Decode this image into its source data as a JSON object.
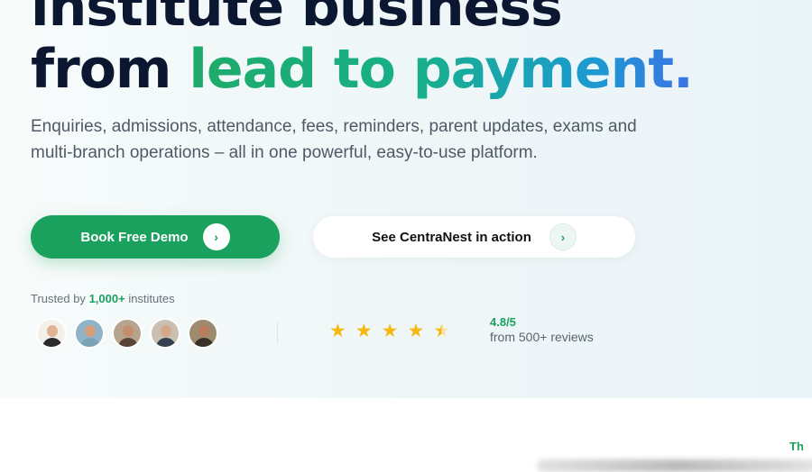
{
  "hero": {
    "headline_line1": "institute business",
    "headline_line2_prefix": "from",
    "headline_line2_highlight": "lead to payment.",
    "subheadline": "Enquiries, admissions, attendance, fees, reminders, parent updates, exams and multi-branch operations – all in one powerful, easy-to-use platform.",
    "primary_cta": {
      "label": "Book Free Demo",
      "icon": "arrow-right-icon",
      "arrow_glyph": "›"
    },
    "secondary_cta": {
      "label": "See CentraNest in action",
      "icon": "arrow-right-icon",
      "arrow_glyph": "›"
    },
    "trusted": {
      "prefix": "Trusted by",
      "count": "1,000+",
      "suffix": "institutes"
    },
    "avatars": [
      {
        "skin": "#e0b394",
        "shirt": "#2b2b2b",
        "bg": "#f3efe9"
      },
      {
        "skin": "#d49e7d",
        "shirt": "#7aa3b8",
        "bg": "#8fb4c9"
      },
      {
        "skin": "#c48e6d",
        "shirt": "#5a4438",
        "bg": "#b7a48f"
      },
      {
        "skin": "#d7a788",
        "shirt": "#34424f",
        "bg": "#c9c0b2"
      },
      {
        "skin": "#b97d5e",
        "shirt": "#3b3028",
        "bg": "#9c8c6f"
      }
    ],
    "rating": {
      "stars": 4.5,
      "star_glyph": "★",
      "score": "4.8/5",
      "reviews": "from 500+ reviews"
    },
    "colors": {
      "accent_green": "#1aa15d",
      "headline_dark": "#0b1630",
      "gradient": [
        "#1faa68",
        "#17b08a",
        "#1c9ad0",
        "#3c72e6"
      ],
      "star": "#f5b90f"
    }
  },
  "below": {
    "peek_text": "Th"
  }
}
